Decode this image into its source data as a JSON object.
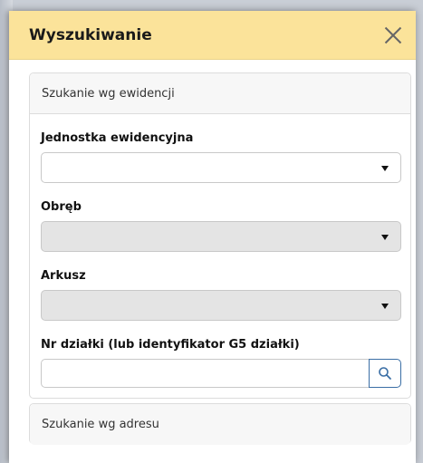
{
  "dialog": {
    "title": "Wyszukiwanie",
    "close_icon": "close-icon"
  },
  "by_register": {
    "header": "Szukanie wg ewidencji",
    "fields": {
      "unit_label": "Jednostka ewidencyjna",
      "unit_value": "",
      "precinct_label": "Obręb",
      "precinct_value": "",
      "sheet_label": "Arkusz",
      "sheet_value": "",
      "parcel_label": "Nr działki (lub identyfikator G5 działki)",
      "parcel_value": "",
      "parcel_placeholder": ""
    },
    "search_icon": "search-icon"
  },
  "by_address": {
    "header": "Szukanie wg adresu"
  },
  "colors": {
    "titlebar": "#fbe39a",
    "search_button_border": "#3a6ea5",
    "disabled_select": "#e4e4e4"
  }
}
